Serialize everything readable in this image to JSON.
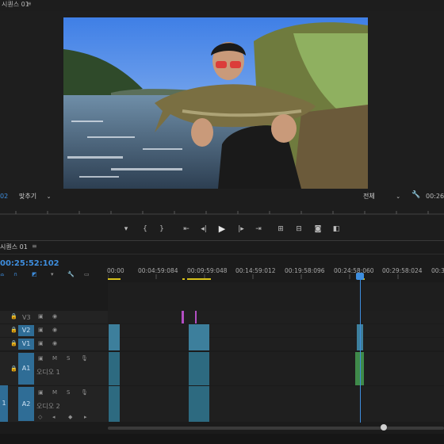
{
  "program_monitor": {
    "title": "시퀀스 01",
    "menu_icon": "≡",
    "timecode_left": "02",
    "fit_select": "맞추기",
    "quality_select": "전체",
    "timecode_right": "00:26"
  },
  "timeline": {
    "title": "시퀀스 01",
    "menu_icon": "≡",
    "timecode": "00:25:52:102",
    "ruler_labels": [
      "00:00",
      "00:04:59:084",
      "00:09:59:048",
      "00:14:59:012",
      "00:19:58:096",
      "00:24:58:060",
      "00:29:58:024",
      "00:3"
    ],
    "tracks": {
      "v3": "V3",
      "v2": "V2",
      "v1": "V1",
      "a1": "A1",
      "a2": "A2",
      "a1_name": "오디오 1",
      "a2_name": "오디오 2",
      "left_a": "1"
    },
    "m": "M",
    "s": "S"
  },
  "colors": {
    "accent_blue": "#3e8ede",
    "clip_video": "#3d7f9c",
    "clip_audio_green": "#3f8a4a",
    "marker_pink": "#b24ec2"
  }
}
